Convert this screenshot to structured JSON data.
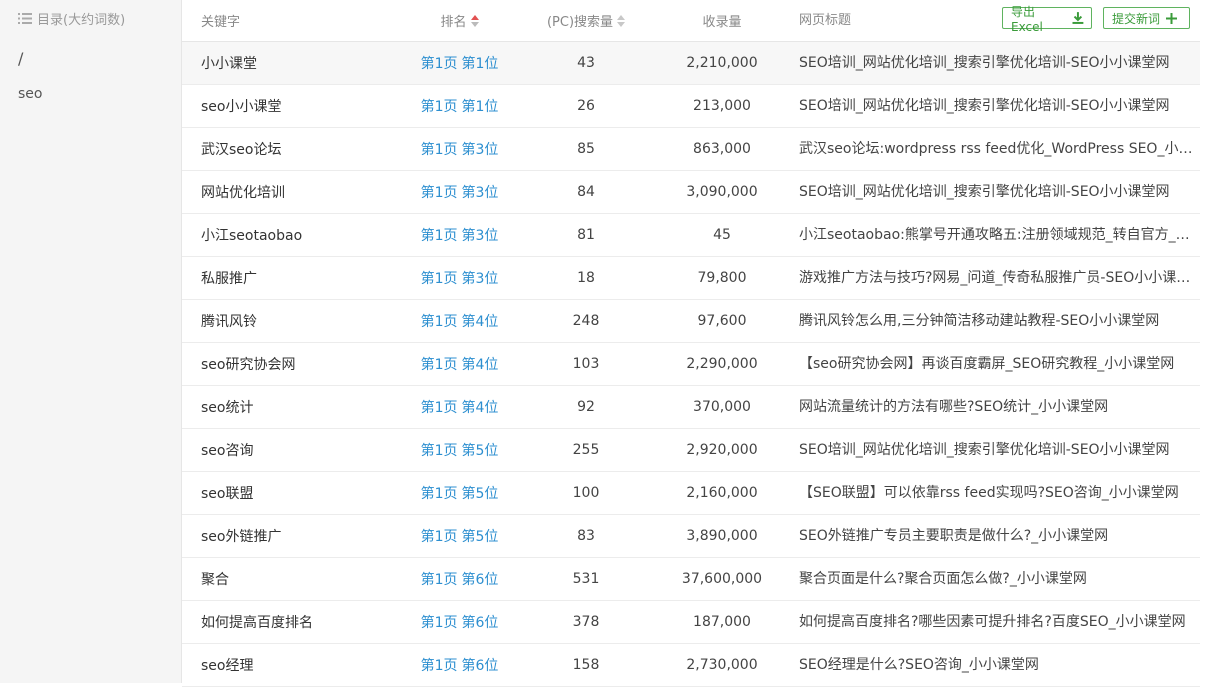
{
  "sidebar": {
    "header": "目录(大约词数)",
    "items": [
      "/",
      "seo"
    ]
  },
  "header": {
    "keyword": "关键字",
    "rank": "排名",
    "pc_volume": "(PC)搜索量",
    "indexed": "收录量",
    "page_title": "网页标题",
    "export_label": "导出Excel",
    "submit_label": "提交新词"
  },
  "rows": [
    {
      "keyword": "小小课堂",
      "page": "第1页",
      "pos": "第1位",
      "pc": "43",
      "indexed": "2,210,000",
      "title": "SEO培训_网站优化培训_搜索引擎优化培训-SEO小小课堂网"
    },
    {
      "keyword": "seo小小课堂",
      "page": "第1页",
      "pos": "第1位",
      "pc": "26",
      "indexed": "213,000",
      "title": "SEO培训_网站优化培训_搜索引擎优化培训-SEO小小课堂网"
    },
    {
      "keyword": "武汉seo论坛",
      "page": "第1页",
      "pos": "第3位",
      "pc": "85",
      "indexed": "863,000",
      "title": "武汉seo论坛:wordpress rss feed优化_WordPress SEO_小小课堂网"
    },
    {
      "keyword": "网站优化培训",
      "page": "第1页",
      "pos": "第3位",
      "pc": "84",
      "indexed": "3,090,000",
      "title": "SEO培训_网站优化培训_搜索引擎优化培训-SEO小小课堂网"
    },
    {
      "keyword": "小江seotaobao",
      "page": "第1页",
      "pos": "第3位",
      "pc": "81",
      "indexed": "45",
      "title": "小江seotaobao:熊掌号开通攻略五:注册领域规范_转自官方_小小课堂网"
    },
    {
      "keyword": "私服推广",
      "page": "第1页",
      "pos": "第3位",
      "pc": "18",
      "indexed": "79,800",
      "title": "游戏推广方法与技巧?网易_问道_传奇私服推广员-SEO小小课堂网"
    },
    {
      "keyword": "腾讯风铃",
      "page": "第1页",
      "pos": "第4位",
      "pc": "248",
      "indexed": "97,600",
      "title": "腾讯风铃怎么用,三分钟简洁移动建站教程-SEO小小课堂网"
    },
    {
      "keyword": "seo研究协会网",
      "page": "第1页",
      "pos": "第4位",
      "pc": "103",
      "indexed": "2,290,000",
      "title": "【seo研究协会网】再谈百度霸屏_SEO研究教程_小小课堂网"
    },
    {
      "keyword": "seo统计",
      "page": "第1页",
      "pos": "第4位",
      "pc": "92",
      "indexed": "370,000",
      "title": "网站流量统计的方法有哪些?SEO统计_小小课堂网"
    },
    {
      "keyword": "seo咨询",
      "page": "第1页",
      "pos": "第5位",
      "pc": "255",
      "indexed": "2,920,000",
      "title": "SEO培训_网站优化培训_搜索引擎优化培训-SEO小小课堂网"
    },
    {
      "keyword": "seo联盟",
      "page": "第1页",
      "pos": "第5位",
      "pc": "100",
      "indexed": "2,160,000",
      "title": "【SEO联盟】可以依靠rss feed实现吗?SEO咨询_小小课堂网"
    },
    {
      "keyword": "seo外链推广",
      "page": "第1页",
      "pos": "第5位",
      "pc": "83",
      "indexed": "3,890,000",
      "title": "SEO外链推广专员主要职责是做什么?_小小课堂网"
    },
    {
      "keyword": "聚合",
      "page": "第1页",
      "pos": "第6位",
      "pc": "531",
      "indexed": "37,600,000",
      "title": "聚合页面是什么?聚合页面怎么做?_小小课堂网"
    },
    {
      "keyword": "如何提高百度排名",
      "page": "第1页",
      "pos": "第6位",
      "pc": "378",
      "indexed": "187,000",
      "title": "如何提高百度排名?哪些因素可提升排名?百度SEO_小小课堂网"
    },
    {
      "keyword": "seo经理",
      "page": "第1页",
      "pos": "第6位",
      "pc": "158",
      "indexed": "2,730,000",
      "title": "SEO经理是什么?SEO咨询_小小课堂网"
    }
  ],
  "colors": {
    "link": "#2d8fd0",
    "button": "#3a9b3a",
    "sort_active": "#e25151"
  },
  "icons": {
    "sidebar": "list-icon",
    "export": "download-icon",
    "submit": "plus-icon",
    "rank_sort": "sort-arrows-icon"
  }
}
